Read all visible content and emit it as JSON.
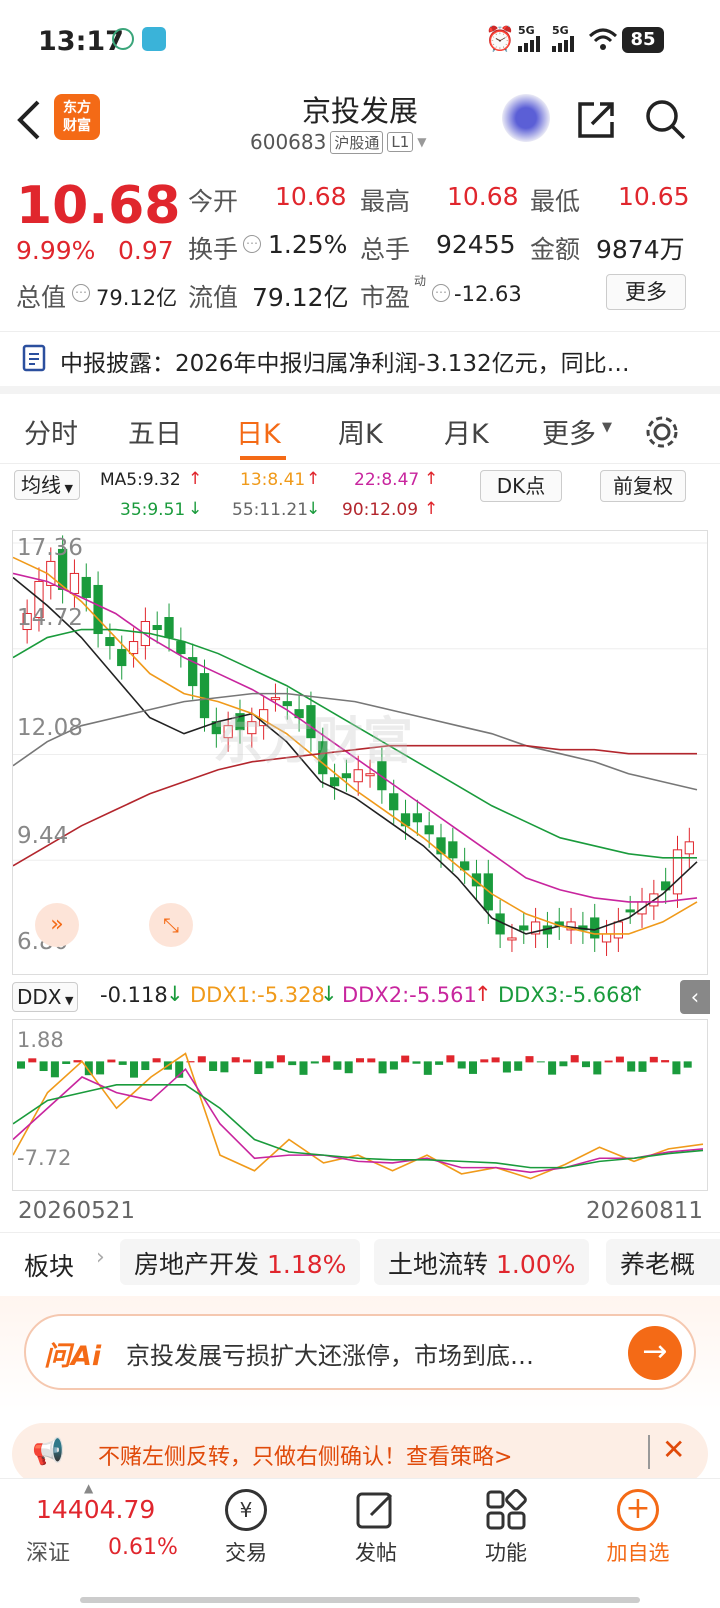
{
  "status": {
    "time": "13:17",
    "battery": "85",
    "net1": "5G",
    "net2": "5G"
  },
  "header": {
    "logo": "东方\n财富",
    "title": "京投发展",
    "code": "600683",
    "market": "沪股通",
    "level": "L1"
  },
  "quote": {
    "price": "10.68",
    "pct": "9.99%",
    "chg": "0.97",
    "open_label": "今开",
    "open": "10.68",
    "high_label": "最高",
    "high": "10.68",
    "low_label": "最低",
    "low": "10.65",
    "turnover_label": "换手",
    "turnover": "1.25%",
    "vol_label": "总手",
    "vol": "92455",
    "amt_label": "金额",
    "amt": "9874万",
    "mcap_label": "总值",
    "mcap": "79.12亿",
    "fcap_label": "流值",
    "fcap": "79.12亿",
    "pe_label": "市盈",
    "pe_sup": "动",
    "pe": "-12.63",
    "more": "更多"
  },
  "notice": {
    "text": "中报披露：2026年中报归属净利润-3.132亿元，同比…"
  },
  "tabs": [
    "分时",
    "五日",
    "日K",
    "周K",
    "月K",
    "更多"
  ],
  "ma": {
    "select": "均线",
    "ma5": "MA5:9.32",
    "ma13": "13:8.41",
    "ma22": "22:8.47",
    "ma35": "35:9.51",
    "ma55": "55:11.21",
    "ma90": "90:12.09",
    "dk": "DK点",
    "fq": "前复权"
  },
  "chart": {
    "y_labels": [
      "17.36",
      "14.72",
      "12.08",
      "9.44",
      "6.80"
    ],
    "watermark": "东方财富"
  },
  "ddx": {
    "select": "DDX",
    "ddx": "-0.118",
    "ddx1": "DDX1:-5.328",
    "ddx2": "DDX2:-5.561",
    "ddx3": "DDX3:-5.668",
    "ytop": "1.88",
    "ybot": "-7.72"
  },
  "dates": {
    "start": "20260521",
    "end": "20260811"
  },
  "sectors": {
    "label": "板块",
    "items": [
      {
        "name": "房地产开发",
        "pct": "1.18%"
      },
      {
        "name": "土地流转",
        "pct": "1.00%"
      },
      {
        "name": "养老概"
      }
    ]
  },
  "ai": {
    "logo": "问Ai",
    "text": "京投发展亏损扩大还涨停，市场到底…"
  },
  "banner": {
    "text": "不赌左侧反转，只做右侧确认！查看策略>"
  },
  "bottom": {
    "index_value": "14404.79",
    "index_name": "深证",
    "index_pct": "0.61%",
    "trade": "交易",
    "post": "发帖",
    "func": "功能",
    "add": "加自选"
  },
  "colors": {
    "up": "#e0262d",
    "down": "#1a9b3c",
    "accent": "#f46a16"
  },
  "chart_data": {
    "type": "candlestick",
    "ylim": [
      6.8,
      17.36
    ],
    "y_ticks": [
      "17.36",
      "14.72",
      "12.08",
      "9.44",
      "6.80"
    ],
    "x_start": "20260521",
    "x_end": "20260811",
    "ma_values": {
      "MA5": 9.32,
      "MA13": 8.41,
      "MA22": 8.47,
      "MA35": 9.51,
      "MA55": 11.21,
      "MA90": 12.09
    },
    "ddx_values": {
      "DDX": -0.118,
      "DDX1": -5.328,
      "DDX2": -5.561,
      "DDX3": -5.668
    },
    "ddx_ylim": [
      -7.72,
      1.88
    ]
  }
}
